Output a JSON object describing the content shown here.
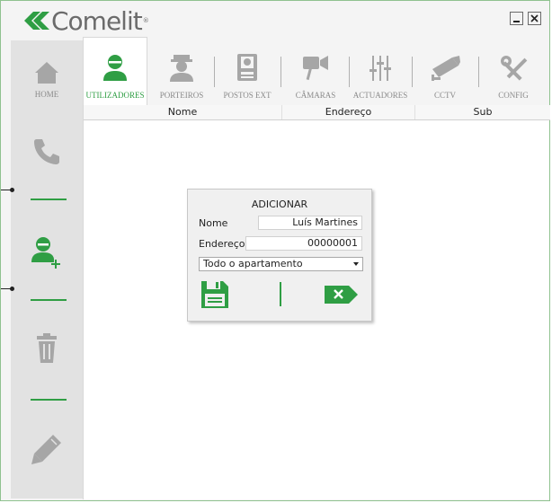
{
  "app": {
    "logo_text": "Comelit",
    "logo_mark": "®"
  },
  "colors": {
    "accent": "#2f9e44",
    "icon_gray": "#a6a6a6",
    "frame_border": "#8fc28f"
  },
  "window_controls": {
    "minimize_icon": "minimize-icon",
    "close_icon": "close-icon"
  },
  "sidebar": {
    "items": [
      {
        "label": "HOME",
        "icon": "home-icon"
      },
      {
        "label": "",
        "icon": "phone-icon"
      },
      {
        "label": "",
        "icon": "add-user-icon"
      },
      {
        "label": "",
        "icon": "trash-icon"
      },
      {
        "label": "",
        "icon": "pencil-icon"
      }
    ]
  },
  "tabs": [
    {
      "label": "UTILIZADORES",
      "icon": "user-icon",
      "active": true
    },
    {
      "label": "PORTEIROS",
      "icon": "doorman-icon"
    },
    {
      "label": "POSTOS EXT",
      "icon": "door-station-icon"
    },
    {
      "label": "CÂMARAS",
      "icon": "camera-icon"
    },
    {
      "label": "ACTUADORES",
      "icon": "sliders-icon"
    },
    {
      "label": "CCTV",
      "icon": "cctv-icon"
    },
    {
      "label": "CONFIG",
      "icon": "tools-icon"
    }
  ],
  "table": {
    "columns": [
      "Nome",
      "Endereço",
      "Sub"
    ]
  },
  "dialog": {
    "title": "ADICIONAR",
    "name_label": "Nome",
    "name_value": "Luís Martines",
    "address_label": "Endereço",
    "address_value": "00000001",
    "select_value": "Todo o apartamento",
    "save_icon": "save-icon",
    "cancel_icon": "cancel-icon"
  }
}
